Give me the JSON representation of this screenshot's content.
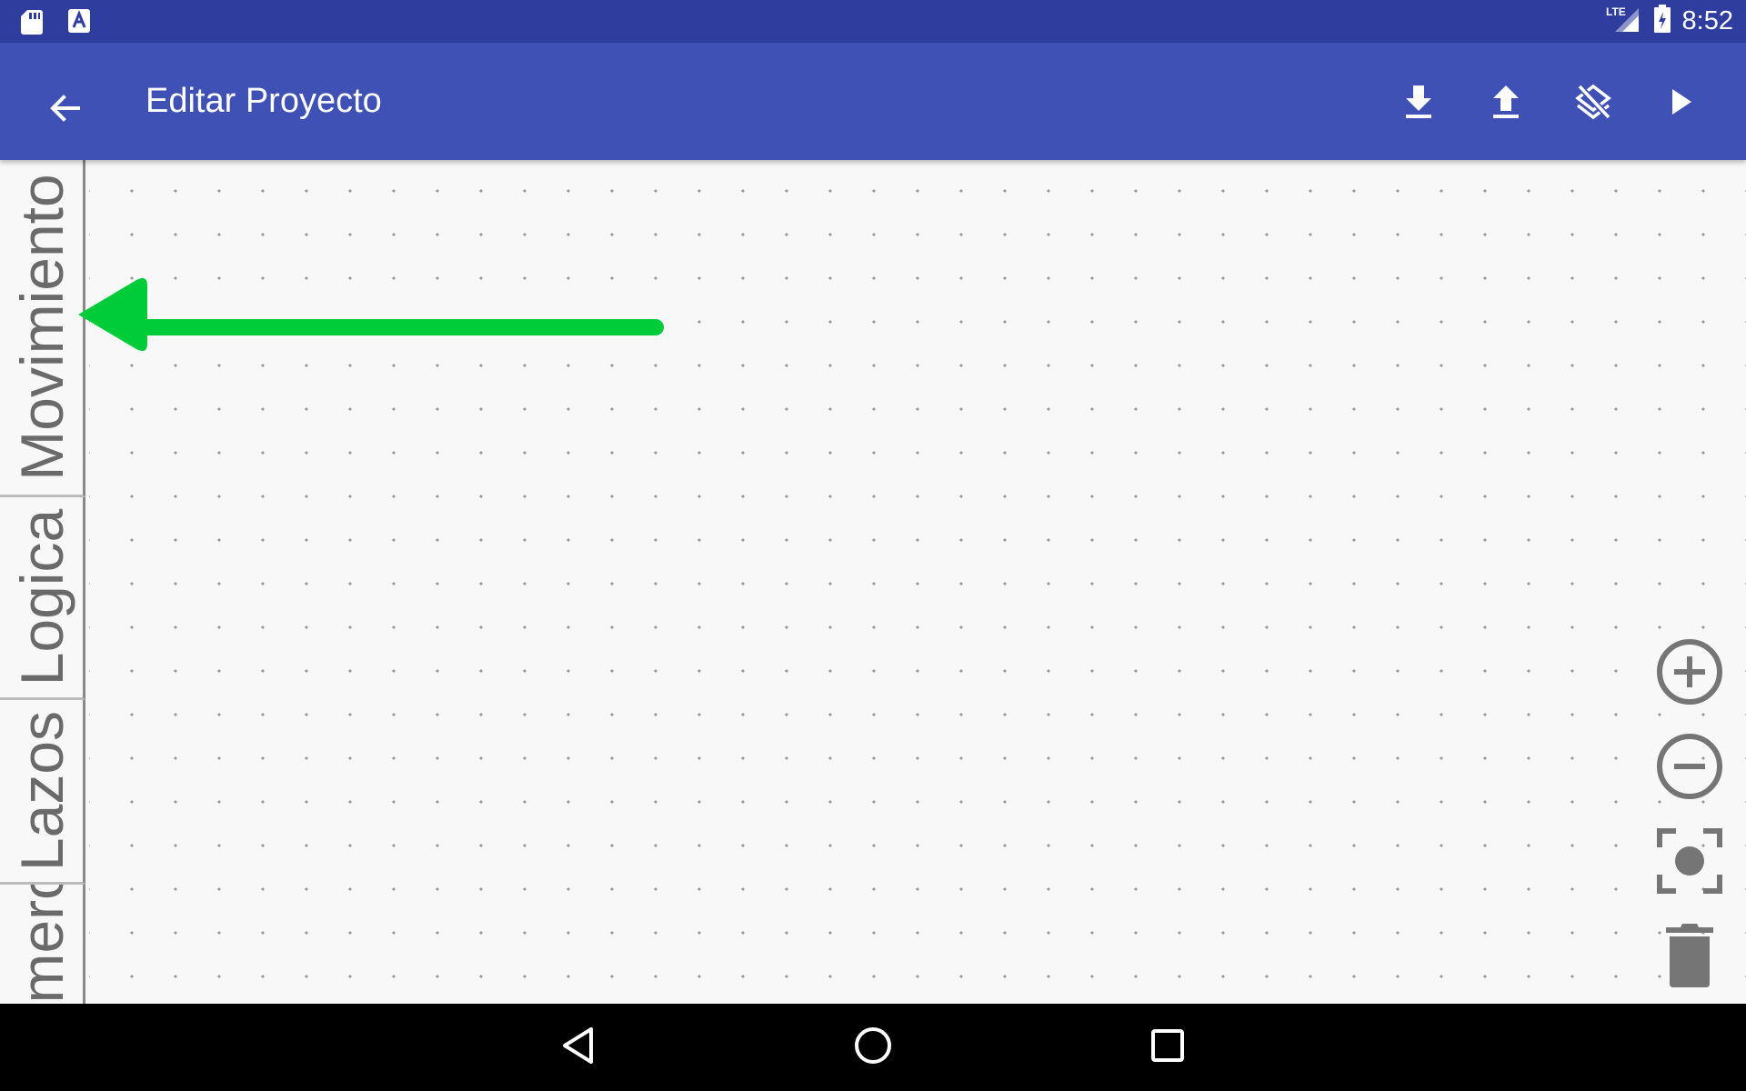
{
  "status_bar": {
    "time": "8:52",
    "network": "LTE",
    "icons": [
      "sd-card-icon",
      "app-notification-icon",
      "signal-icon",
      "battery-icon"
    ]
  },
  "app_bar": {
    "title": "Editar Proyecto",
    "back_icon": "arrow-back-icon",
    "actions": [
      "download-icon",
      "upload-icon",
      "layers-clear-icon",
      "play-icon"
    ],
    "color": "#3f51b5",
    "status_color": "#2f3e9e"
  },
  "categories": {
    "tabs": [
      {
        "label": "Movimiento"
      },
      {
        "label": "Logica"
      },
      {
        "label": "Lazos"
      },
      {
        "label": "Numeros"
      }
    ]
  },
  "annotation": {
    "type": "arrow",
    "direction": "left",
    "color": "#00cc3a"
  },
  "workspace_controls": [
    "zoom-in-icon",
    "zoom-out-icon",
    "recenter-icon",
    "trash-icon"
  ],
  "nav_bar": [
    "back-nav-icon",
    "home-nav-icon",
    "recents-nav-icon"
  ]
}
